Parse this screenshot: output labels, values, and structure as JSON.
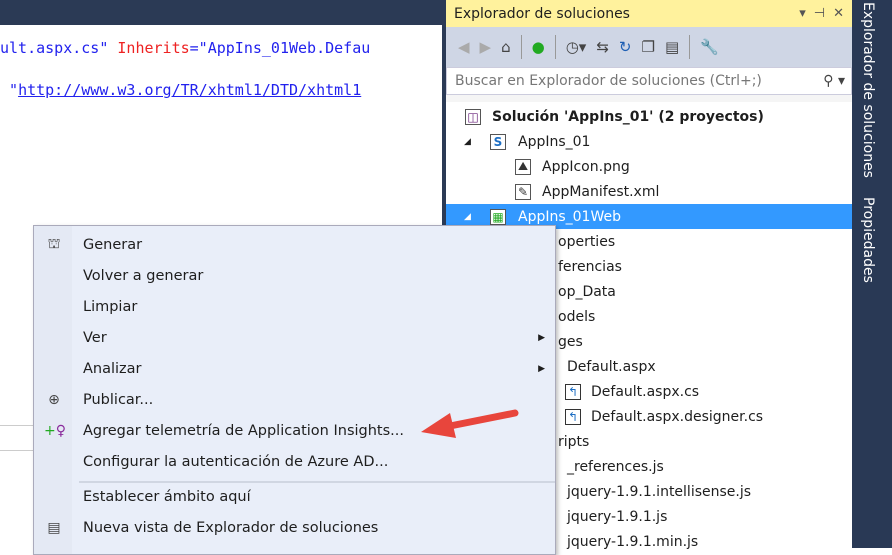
{
  "editor": {
    "line1": {
      "part1": "ult.aspx.cs\" ",
      "attr": "Inherits",
      "part2": "=\"AppIns_01Web.Defau"
    },
    "line2": {
      "quote": " \"",
      "link": "http://www.w3.org/TR/xhtml1/DTD/xhtml1"
    }
  },
  "solution_explorer": {
    "title": "Explorador de soluciones",
    "title_controls": [
      "▾",
      "⊣",
      "✕"
    ],
    "search_placeholder": "Buscar en Explorador de soluciones (Ctrl+;)",
    "toolbar_icons": [
      "back-icon",
      "forward-icon",
      "home-icon",
      "sync-icon",
      "history-icon",
      "sync-arrows-icon",
      "refresh-icon",
      "collapse-icon",
      "copy-icon",
      "wrench-icon"
    ],
    "tree": [
      {
        "label": "Solución 'AppIns_01'  (2 proyectos)",
        "bold": true
      },
      {
        "label": "AppIns_01"
      },
      {
        "label": "AppIcon.png"
      },
      {
        "label": "AppManifest.xml"
      },
      {
        "label": "AppIns_01Web",
        "selected": true
      },
      {
        "label": "operties"
      },
      {
        "label": "ferencias"
      },
      {
        "label": "op_Data"
      },
      {
        "label": "odels"
      },
      {
        "label": "ges"
      },
      {
        "label": "Default.aspx"
      },
      {
        "label": "Default.aspx.cs"
      },
      {
        "label": "Default.aspx.designer.cs"
      },
      {
        "label": "ripts"
      },
      {
        "label": "_references.js"
      },
      {
        "label": "jquery-1.9.1.intellisense.js"
      },
      {
        "label": "jquery-1.9.1.js"
      },
      {
        "label": "jquery-1.9.1.min.js"
      }
    ]
  },
  "side_tabs": [
    "Explorador de soluciones",
    "Propiedades"
  ],
  "context_menu": {
    "items": [
      {
        "label": "Generar",
        "icon": "build-icon"
      },
      {
        "label": "Volver a generar"
      },
      {
        "label": "Limpiar"
      },
      {
        "label": "Ver",
        "submenu": true
      },
      {
        "label": "Analizar",
        "submenu": true
      },
      {
        "label": "Publicar...",
        "icon": "publish-icon"
      },
      {
        "label": "Agregar telemetría de Application Insights...",
        "icon": "app-insights-icon"
      },
      {
        "label": "Configurar la autenticación de Azure AD..."
      },
      {
        "label": "Establecer ámbito aquí"
      },
      {
        "label": "Nueva vista de Explorador de soluciones",
        "icon": "new-view-icon"
      }
    ]
  },
  "colors": {
    "accent": "#3399ff",
    "annotation_arrow": "#e8453c",
    "title_bar": "#fff29d",
    "chrome": "#293955"
  }
}
